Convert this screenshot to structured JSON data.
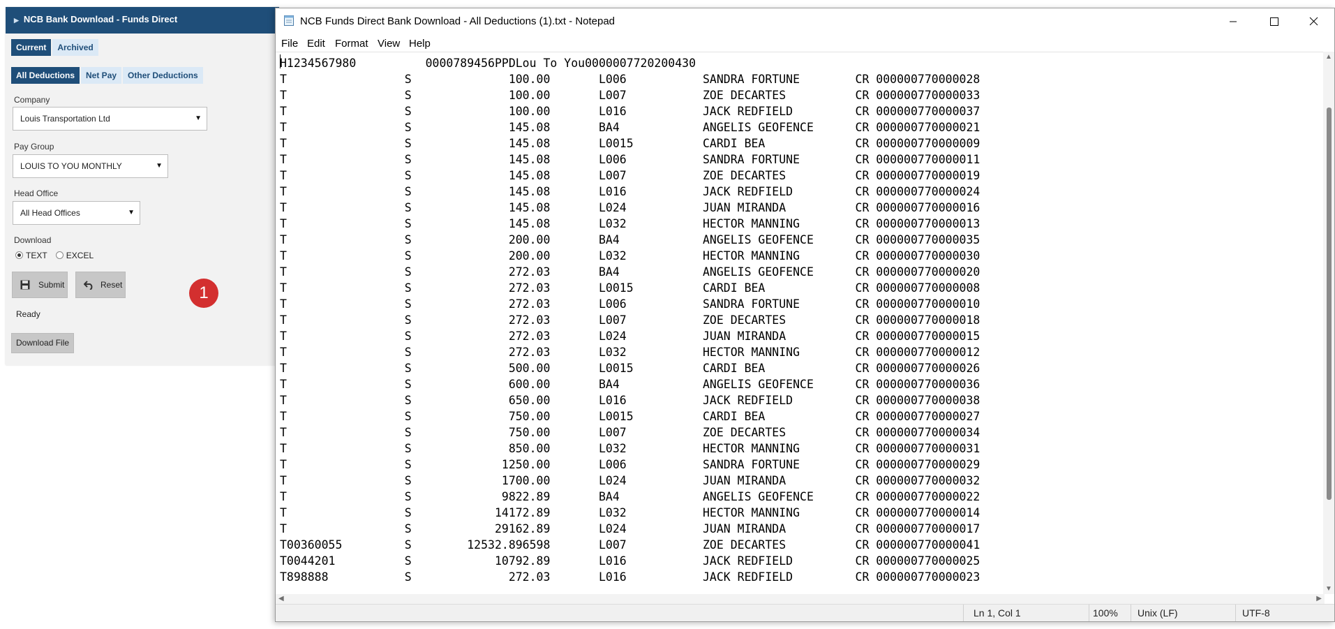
{
  "web_panel": {
    "header_title": "NCB Bank Download - Funds Direct",
    "tabs": [
      "Current",
      "Archived"
    ],
    "subtabs": [
      "All Deductions",
      "Net Pay",
      "Other Deductions"
    ],
    "company": {
      "label": "Company",
      "value": "Louis Transportation Ltd"
    },
    "pay_group": {
      "label": "Pay Group",
      "value": "LOUIS TO YOU MONTHLY"
    },
    "head_office": {
      "label": "Head Office",
      "value": "All Head Offices"
    },
    "download": {
      "label": "Download",
      "options": [
        "TEXT",
        "EXCEL"
      ],
      "selected": "TEXT"
    },
    "submit_label": "Submit",
    "reset_label": "Reset",
    "status": "Ready",
    "download_file_label": "Download File",
    "badge": "1",
    "colors": {
      "header": "#1f4e79",
      "tab_active": "#1f4e79",
      "badge": "#d32f2f"
    }
  },
  "notepad": {
    "title": "NCB Funds Direct Bank Download - All Deductions (1).txt - Notepad",
    "menu": [
      "File",
      "Edit",
      "Format",
      "View",
      "Help"
    ],
    "header_line": "H1234567980          0000789456PPDLou To You0000007720200430",
    "rows": [
      [
        "T",
        "S",
        "100.00",
        "L006",
        "SANDRA FORTUNE",
        "CR 000000770000028"
      ],
      [
        "T",
        "S",
        "100.00",
        "L007",
        "ZOE DECARTES",
        "CR 000000770000033"
      ],
      [
        "T",
        "S",
        "100.00",
        "L016",
        "JACK REDFIELD",
        "CR 000000770000037"
      ],
      [
        "T",
        "S",
        "145.08",
        "BA4",
        "ANGELIS GEOFENCE",
        "CR 000000770000021"
      ],
      [
        "T",
        "S",
        "145.08",
        "L0015",
        "CARDI BEA",
        "CR 000000770000009"
      ],
      [
        "T",
        "S",
        "145.08",
        "L006",
        "SANDRA FORTUNE",
        "CR 000000770000011"
      ],
      [
        "T",
        "S",
        "145.08",
        "L007",
        "ZOE DECARTES",
        "CR 000000770000019"
      ],
      [
        "T",
        "S",
        "145.08",
        "L016",
        "JACK REDFIELD",
        "CR 000000770000024"
      ],
      [
        "T",
        "S",
        "145.08",
        "L024",
        "JUAN MIRANDA",
        "CR 000000770000016"
      ],
      [
        "T",
        "S",
        "145.08",
        "L032",
        "HECTOR MANNING",
        "CR 000000770000013"
      ],
      [
        "T",
        "S",
        "200.00",
        "BA4",
        "ANGELIS GEOFENCE",
        "CR 000000770000035"
      ],
      [
        "T",
        "S",
        "200.00",
        "L032",
        "HECTOR MANNING",
        "CR 000000770000030"
      ],
      [
        "T",
        "S",
        "272.03",
        "BA4",
        "ANGELIS GEOFENCE",
        "CR 000000770000020"
      ],
      [
        "T",
        "S",
        "272.03",
        "L0015",
        "CARDI BEA",
        "CR 000000770000008"
      ],
      [
        "T",
        "S",
        "272.03",
        "L006",
        "SANDRA FORTUNE",
        "CR 000000770000010"
      ],
      [
        "T",
        "S",
        "272.03",
        "L007",
        "ZOE DECARTES",
        "CR 000000770000018"
      ],
      [
        "T",
        "S",
        "272.03",
        "L024",
        "JUAN MIRANDA",
        "CR 000000770000015"
      ],
      [
        "T",
        "S",
        "272.03",
        "L032",
        "HECTOR MANNING",
        "CR 000000770000012"
      ],
      [
        "T",
        "S",
        "500.00",
        "L0015",
        "CARDI BEA",
        "CR 000000770000026"
      ],
      [
        "T",
        "S",
        "600.00",
        "BA4",
        "ANGELIS GEOFENCE",
        "CR 000000770000036"
      ],
      [
        "T",
        "S",
        "650.00",
        "L016",
        "JACK REDFIELD",
        "CR 000000770000038"
      ],
      [
        "T",
        "S",
        "750.00",
        "L0015",
        "CARDI BEA",
        "CR 000000770000027"
      ],
      [
        "T",
        "S",
        "750.00",
        "L007",
        "ZOE DECARTES",
        "CR 000000770000034"
      ],
      [
        "T",
        "S",
        "850.00",
        "L032",
        "HECTOR MANNING",
        "CR 000000770000031"
      ],
      [
        "T",
        "S",
        "1250.00",
        "L006",
        "SANDRA FORTUNE",
        "CR 000000770000029"
      ],
      [
        "T",
        "S",
        "1700.00",
        "L024",
        "JUAN MIRANDA",
        "CR 000000770000032"
      ],
      [
        "T",
        "S",
        "9822.89",
        "BA4",
        "ANGELIS GEOFENCE",
        "CR 000000770000022"
      ],
      [
        "T",
        "S",
        "14172.89",
        "L032",
        "HECTOR MANNING",
        "CR 000000770000014"
      ],
      [
        "T",
        "S",
        "29162.89",
        "L024",
        "JUAN MIRANDA",
        "CR 000000770000017"
      ],
      [
        "T00360055",
        "S",
        "12532.896598",
        "L007",
        "ZOE DECARTES",
        "CR 000000770000041"
      ],
      [
        "T0044201",
        "S",
        "10792.89",
        "L016",
        "JACK REDFIELD",
        "CR 000000770000025"
      ],
      [
        "T898888",
        "S",
        "272.03",
        "L016",
        "JACK REDFIELD",
        "CR 000000770000023"
      ]
    ],
    "status": {
      "position": "Ln 1, Col 1",
      "zoom": "100%",
      "line_ending": "Unix (LF)",
      "encoding": "UTF-8"
    }
  }
}
